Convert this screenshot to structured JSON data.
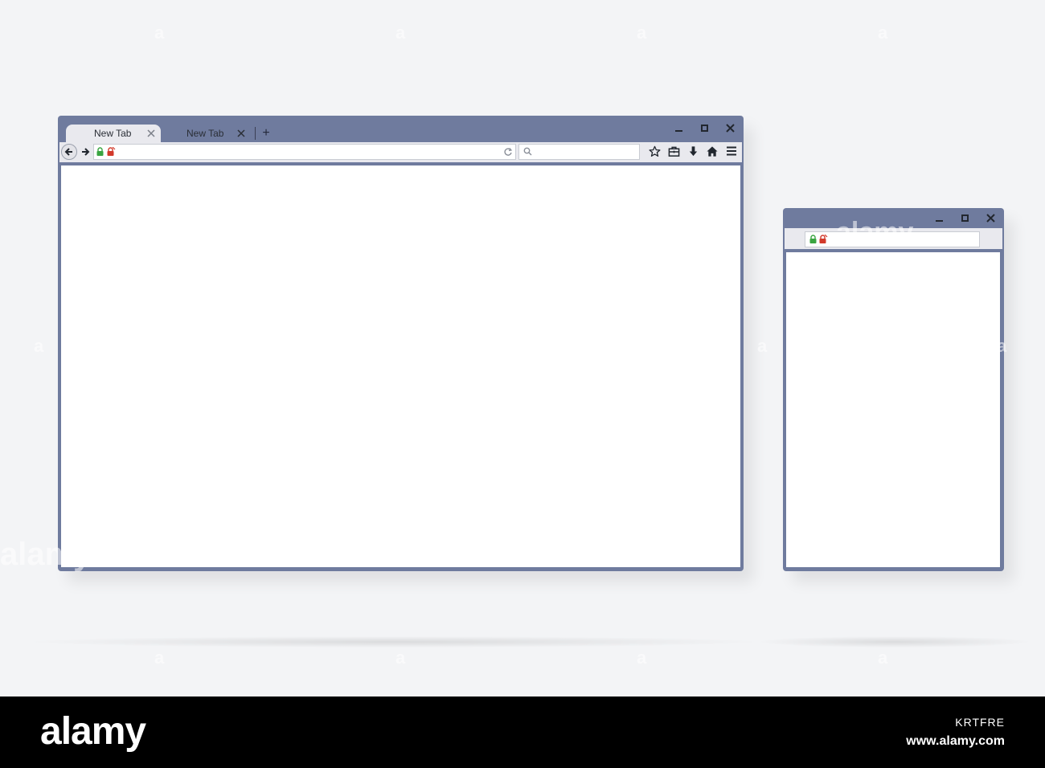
{
  "large_window": {
    "tabs": [
      {
        "label": "New Tab",
        "active": true
      },
      {
        "label": "New Tab",
        "active": false
      }
    ],
    "new_tab_label": "+",
    "address_value": "",
    "search_value": "",
    "toolbar_icons": [
      "star-icon",
      "briefcase-icon",
      "download-icon",
      "home-icon",
      "menu-icon"
    ]
  },
  "small_window": {
    "address_value": ""
  },
  "colors": {
    "frame": "#6f7b9e",
    "toolbar": "#e9e9ee",
    "secure_lock": "#3aa541",
    "insecure_lock": "#d23a2b"
  },
  "watermark": {
    "text": "alamy",
    "tile_char": "a"
  },
  "footer": {
    "brand": "alamy",
    "image_id": "KRTFRE",
    "site": "www.alamy.com"
  }
}
